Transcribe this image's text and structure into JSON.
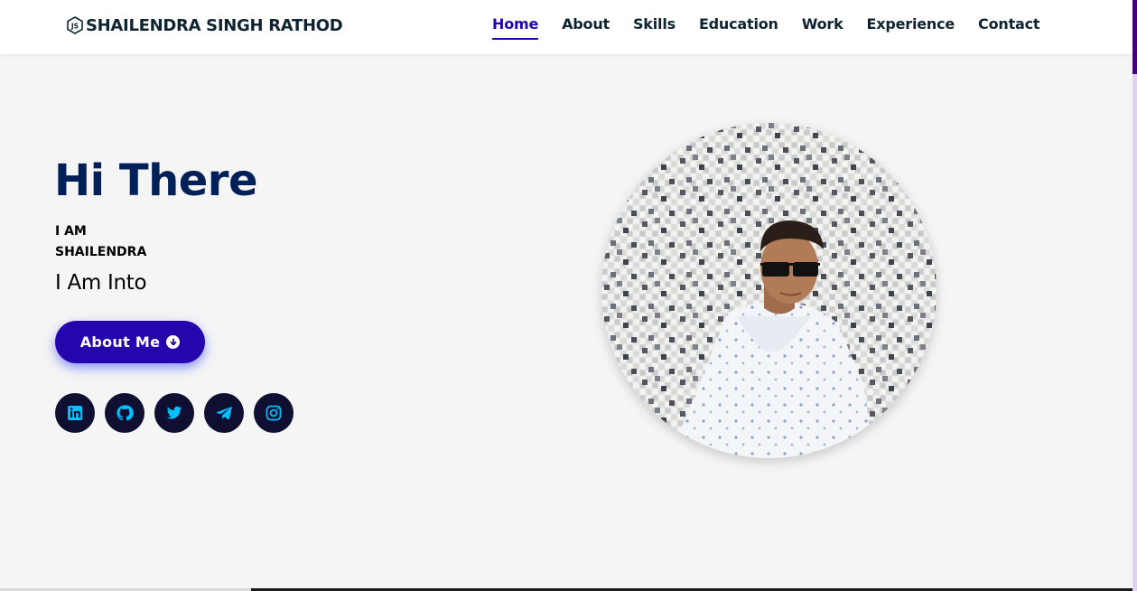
{
  "header": {
    "brand": {
      "icon": "nodejs-js-logo-icon",
      "icon_text": "JS",
      "name": "SHAILENDRA SINGH RATHOD"
    },
    "nav": [
      {
        "label": "Home",
        "active": true
      },
      {
        "label": "About"
      },
      {
        "label": "Skills"
      },
      {
        "label": "Education"
      },
      {
        "label": "Work"
      },
      {
        "label": "Experience"
      },
      {
        "label": "Contact"
      }
    ]
  },
  "hero": {
    "greeting": "Hi There",
    "iam_line1": "I AM",
    "iam_line2": "SHAILENDRA",
    "into": "I Am Into",
    "button": {
      "label": "About Me",
      "icon": "arrow-circle-down-icon"
    },
    "socials": [
      {
        "name": "linkedin-icon"
      },
      {
        "name": "github-icon"
      },
      {
        "name": "twitter-icon"
      },
      {
        "name": "telegram-icon"
      },
      {
        "name": "instagram-icon"
      }
    ],
    "photo": {
      "subject": "profile-photo"
    }
  },
  "colors": {
    "accent": "#2506ad",
    "heading": "#002057",
    "text_dark": "#0e2431",
    "social_bg": "#0e0f31",
    "social_icon": "#00bfff",
    "background": "#f5f5f5",
    "scrollbar_thumb": "#420177"
  }
}
